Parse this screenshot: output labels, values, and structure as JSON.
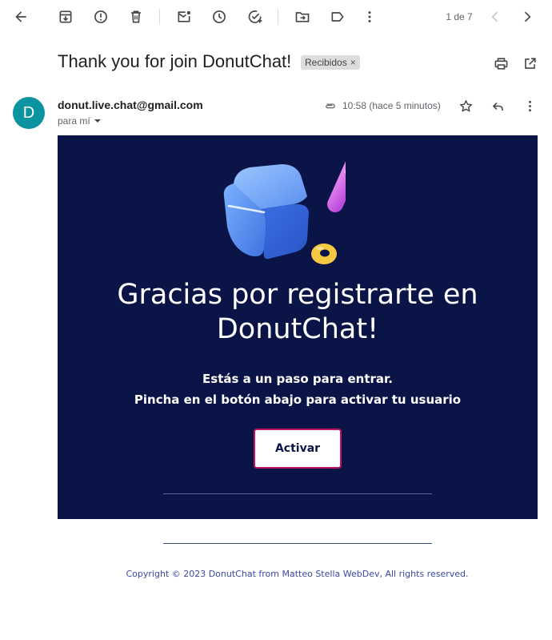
{
  "toolbar": {
    "back_icon": "arrow-left-icon",
    "archive_icon": "archive-icon",
    "report_icon": "report-spam-icon",
    "delete_icon": "trash-icon",
    "mark_unread_icon": "mark-unread-icon",
    "snooze_icon": "clock-icon",
    "add_task_icon": "add-task-icon",
    "move_icon": "move-to-folder-icon",
    "label_icon": "label-icon",
    "more_icon": "more-vertical-icon",
    "pager_text": "1 de 7",
    "prev_icon": "chevron-left-icon",
    "next_icon": "chevron-right-icon"
  },
  "message": {
    "subject": "Thank you for join DonutChat!",
    "label": "Recibidos",
    "label_remove": "×",
    "sender_initial": "D",
    "sender_email": "donut.live.chat@gmail.com",
    "recipient": "para mí",
    "time": "10:58 (hace 5 minutos)"
  },
  "email": {
    "headline": "Gracias por registrarte en DonutChat!",
    "lead_line1": "Estás a un paso para entrar.",
    "lead_line2": "Pincha en el botón abajo para activar tu usuario",
    "button_label": "Activar",
    "footer": "Copyright © 2023 DonutChat from Matteo Stella WebDev, All rights reserved."
  },
  "colors": {
    "email_background": "#0b1446",
    "button_border": "#c2136a",
    "avatar": "#0b94a0",
    "footer_text": "#3a4aa0"
  }
}
